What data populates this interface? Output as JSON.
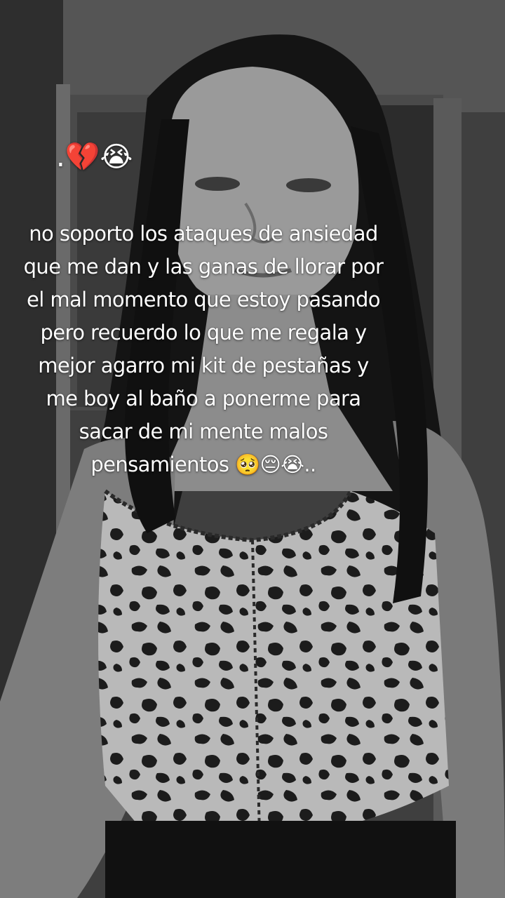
{
  "overlay": {
    "header_text": ".💔😭",
    "lines": [
      "no soporto los ataques de ansiedad",
      "que me dan y las ganas de llorar por",
      "el mal momento que estoy pasando",
      "pero recuerdo lo que me regala y",
      "mejor agarro mi kit de pestañas y",
      "me boy al baño a ponerme para",
      "sacar de mi mente malos",
      "pensamientos 🥺😔😭.."
    ]
  }
}
